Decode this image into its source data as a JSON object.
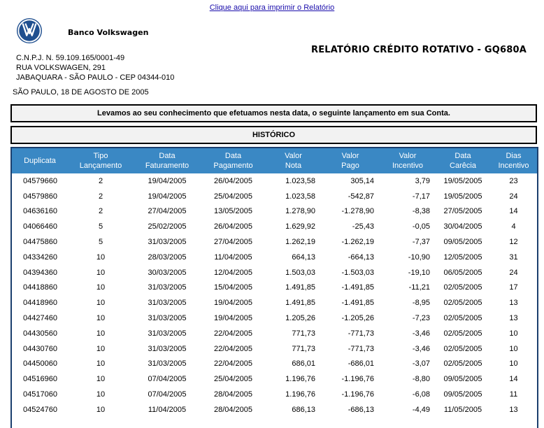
{
  "print_link": "Clique aqui para imprimir o Relatório",
  "bank_name": "Banco Volkswagen",
  "address": {
    "cnpj": "C.N.P.J. N. 59.109.165/0001-49",
    "street": "RUA VOLKSWAGEN, 291",
    "city": "JABAQUARA - SÃO PAULO - CEP 04344-010"
  },
  "report_title": "RELATÓRIO CRÉDITO ROTATIVO - GQ680A",
  "date_line": "SÃO PAULO, 18 DE AGOSTO DE 2005",
  "notice": "Levamos ao seu conhecimento que efetuamos nesta data, o seguinte lançamento em sua Conta.",
  "history_title": "HISTÓRICO",
  "colors": {
    "header_bg": "#3a88c4",
    "border": "#1b3f6e",
    "logo_blue": "#1f4f8f"
  },
  "table": {
    "headers": [
      [
        "Duplicata",
        ""
      ],
      [
        "Tipo",
        "Lançamento"
      ],
      [
        "Data",
        "Faturamento"
      ],
      [
        "Data",
        "Pagamento"
      ],
      [
        "Valor",
        "Nota"
      ],
      [
        "Valor",
        "Pago"
      ],
      [
        "Valor",
        "Incentivo"
      ],
      [
        "Data",
        "Carêcia"
      ],
      [
        "Dias",
        "Incentivo"
      ]
    ],
    "rows": [
      [
        "04579660",
        "2",
        "19/04/2005",
        "26/04/2005",
        "1.023,58",
        "305,14",
        "3,79",
        "19/05/2005",
        "23"
      ],
      [
        "04579860",
        "2",
        "19/04/2005",
        "25/04/2005",
        "1.023,58",
        "-542,87",
        "-7,17",
        "19/05/2005",
        "24"
      ],
      [
        "04636160",
        "2",
        "27/04/2005",
        "13/05/2005",
        "1.278,90",
        "-1.278,90",
        "-8,38",
        "27/05/2005",
        "14"
      ],
      [
        "04066460",
        "5",
        "25/02/2005",
        "26/04/2005",
        "1.629,92",
        "-25,43",
        "-0,05",
        "30/04/2005",
        "4"
      ],
      [
        "04475860",
        "5",
        "31/03/2005",
        "27/04/2005",
        "1.262,19",
        "-1.262,19",
        "-7,37",
        "09/05/2005",
        "12"
      ],
      [
        "04334260",
        "10",
        "28/03/2005",
        "11/04/2005",
        "664,13",
        "-664,13",
        "-10,90",
        "12/05/2005",
        "31"
      ],
      [
        "04394360",
        "10",
        "30/03/2005",
        "12/04/2005",
        "1.503,03",
        "-1.503,03",
        "-19,10",
        "06/05/2005",
        "24"
      ],
      [
        "04418860",
        "10",
        "31/03/2005",
        "15/04/2005",
        "1.491,85",
        "-1.491,85",
        "-11,21",
        "02/05/2005",
        "17"
      ],
      [
        "04418960",
        "10",
        "31/03/2005",
        "19/04/2005",
        "1.491,85",
        "-1.491,85",
        "-8,95",
        "02/05/2005",
        "13"
      ],
      [
        "04427460",
        "10",
        "31/03/2005",
        "19/04/2005",
        "1.205,26",
        "-1.205,26",
        "-7,23",
        "02/05/2005",
        "13"
      ],
      [
        "04430560",
        "10",
        "31/03/2005",
        "22/04/2005",
        "771,73",
        "-771,73",
        "-3,46",
        "02/05/2005",
        "10"
      ],
      [
        "04430760",
        "10",
        "31/03/2005",
        "22/04/2005",
        "771,73",
        "-771,73",
        "-3,46",
        "02/05/2005",
        "10"
      ],
      [
        "04450060",
        "10",
        "31/03/2005",
        "22/04/2005",
        "686,01",
        "-686,01",
        "-3,07",
        "02/05/2005",
        "10"
      ],
      [
        "04516960",
        "10",
        "07/04/2005",
        "25/04/2005",
        "1.196,76",
        "-1.196,76",
        "-8,80",
        "09/05/2005",
        "14"
      ],
      [
        "04517060",
        "10",
        "07/04/2005",
        "28/04/2005",
        "1.196,76",
        "-1.196,76",
        "-6,08",
        "09/05/2005",
        "11"
      ],
      [
        "04524760",
        "10",
        "11/04/2005",
        "28/04/2005",
        "686,13",
        "-686,13",
        "-4,49",
        "11/05/2005",
        "13"
      ]
    ]
  }
}
